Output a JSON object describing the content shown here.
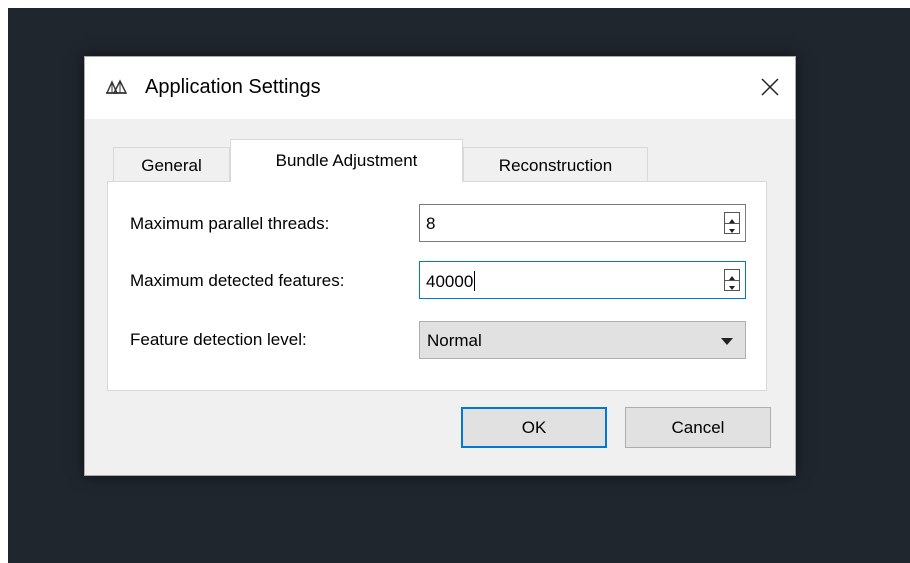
{
  "dialog": {
    "title": "Application Settings",
    "icon": "app-logo-icon",
    "close_icon": "close-icon"
  },
  "tabs": [
    {
      "label": "General",
      "active": false
    },
    {
      "label": "Bundle Adjustment",
      "active": true
    },
    {
      "label": "Reconstruction",
      "active": false
    }
  ],
  "fields": {
    "threads": {
      "label": "Maximum parallel threads:",
      "value": "8"
    },
    "features": {
      "label": "Maximum detected features:",
      "value": "40000"
    },
    "level": {
      "label": "Feature detection level:",
      "value": "Normal"
    }
  },
  "buttons": {
    "ok": "OK",
    "cancel": "Cancel"
  },
  "colors": {
    "backdrop": "#20262e",
    "dialog": "#f0f0f0",
    "focus_accent": "#0078d7"
  }
}
